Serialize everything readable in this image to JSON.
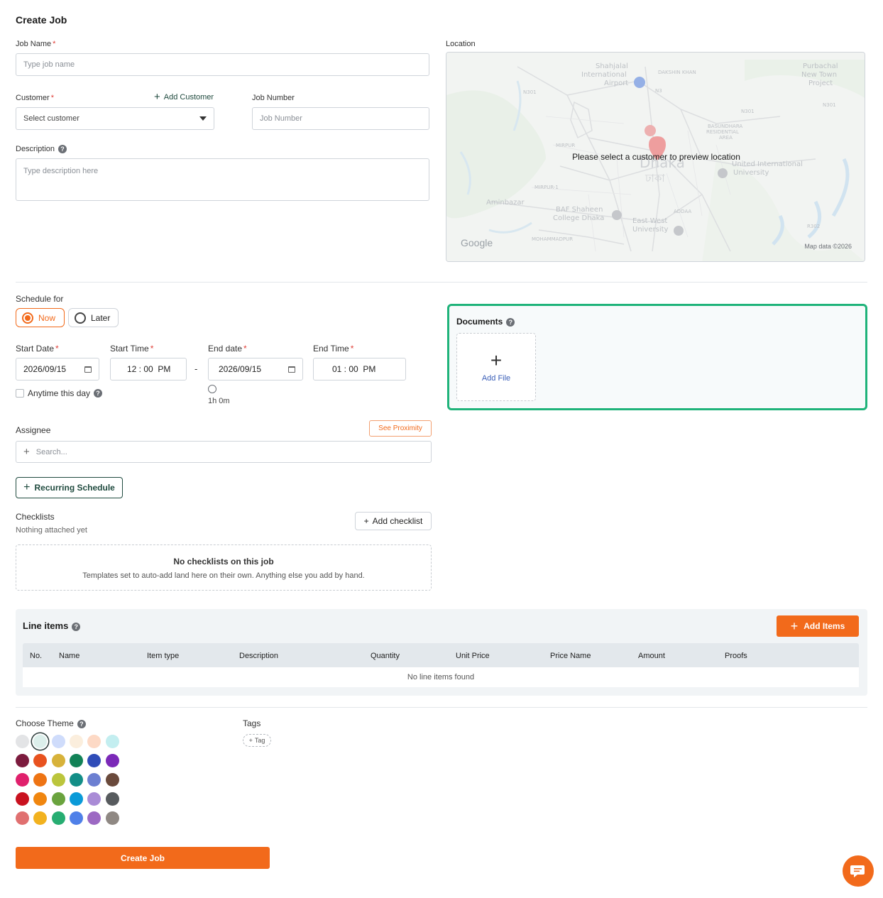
{
  "page": {
    "title": "Create Job"
  },
  "job_name": {
    "label": "Job Name",
    "placeholder": "Type job name"
  },
  "customer": {
    "label": "Customer",
    "add_label": "Add Customer",
    "placeholder": "Select customer"
  },
  "job_number": {
    "label": "Job Number",
    "placeholder": "Job Number"
  },
  "description": {
    "label": "Description",
    "placeholder": "Type description here"
  },
  "location": {
    "label": "Location",
    "overlay_text": "Please select a customer to preview location",
    "map_labels": [
      "Shahjalal International Airport",
      "DAKSHIN KHAN",
      "Purbachal New Town Project",
      "BASUNDHARA RESIDENTIAL AREA",
      "MIRPUR",
      "Dhaka",
      "ঢাকা",
      "United International University",
      "MIRPUR-1",
      "Aminbazar",
      "BAF Shaheen College Dhaka",
      "ADDAA",
      "East West University",
      "MOHAMMADPUR",
      "N301",
      "N3",
      "N301",
      "N301",
      "R302"
    ],
    "google": "Google",
    "attribution": "Map data ©2026"
  },
  "schedule": {
    "label": "Schedule for",
    "options": [
      "Now",
      "Later"
    ],
    "selected": "Now",
    "start_date": {
      "label": "Start Date",
      "value": "2026/09/15"
    },
    "start_time": {
      "label": "Start Time",
      "value": "12 : 00  PM"
    },
    "end_date": {
      "label": "End date",
      "value": "2026/09/15"
    },
    "end_time": {
      "label": "End Time",
      "value": "01 : 00  PM"
    },
    "separator": "-",
    "duration": "1h 0m",
    "anytime_label": "Anytime this day"
  },
  "documents": {
    "label": "Documents",
    "add_file": "Add File"
  },
  "assignee": {
    "label": "Assignee",
    "proximity_button": "See Proximity",
    "search_placeholder": "Search..."
  },
  "recurring_button": "Recurring Schedule",
  "checklists": {
    "label": "Checklists",
    "status": "Nothing attached yet",
    "add_button": "Add checklist",
    "empty_title": "No checklists on this job",
    "empty_text": "Templates set to auto-add land here on their own. Anything else you add by hand."
  },
  "line_items": {
    "label": "Line items",
    "add_button": "Add Items",
    "columns": [
      "No.",
      "Name",
      "Item type",
      "Description",
      "Quantity",
      "Unit Price",
      "Price Name",
      "Amount",
      "Proofs"
    ],
    "empty": "No line items found"
  },
  "theme": {
    "label": "Choose Theme",
    "selected_index": 1,
    "colors": [
      [
        "#e3e4e6",
        "#dcefeb",
        "#cfdcfb",
        "#fbeedd",
        "#fdd9c5",
        "#c3eef0"
      ],
      [
        "#7c1b3e",
        "#e8521f",
        "#d7b23a",
        "#128257",
        "#2f4cb8",
        "#7b29b8"
      ],
      [
        "#e0206c",
        "#ee7414",
        "#bbc53c",
        "#138e87",
        "#6c7fd1",
        "#6a4a3c"
      ],
      [
        "#c9111f",
        "#f0860f",
        "#6aa33e",
        "#0a9ad8",
        "#a98bd6",
        "#575b5e"
      ],
      [
        "#e07070",
        "#f2b21f",
        "#27ad72",
        "#4f80e8",
        "#9c69c3",
        "#8f8883"
      ]
    ]
  },
  "tags": {
    "label": "Tags",
    "add_label": "Tag"
  },
  "submit_button": "Create Job",
  "accent": "#f26a1b",
  "success": "#1fb37a",
  "brand_dark": "#1f4a3e"
}
